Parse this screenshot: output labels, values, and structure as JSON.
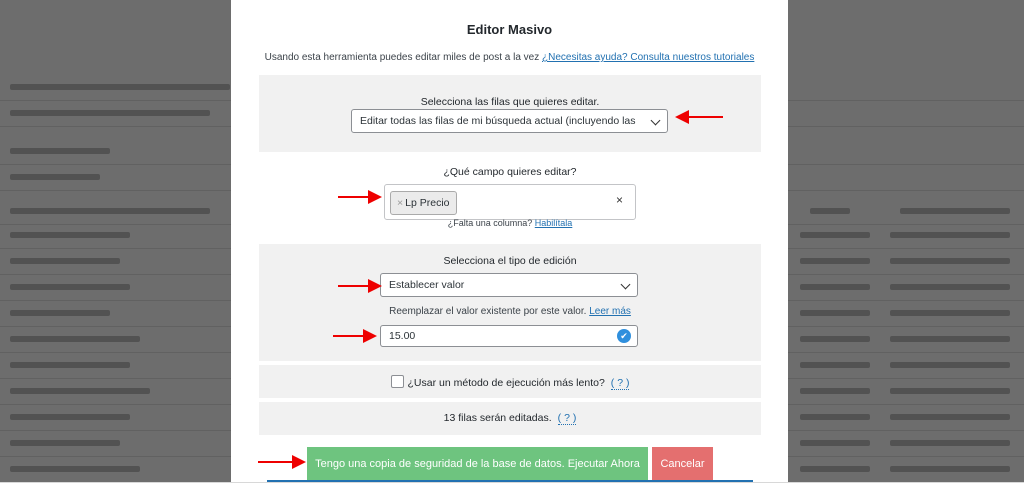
{
  "modal": {
    "title": "Editor Masivo",
    "intro_text": "Usando esta herramienta puedes editar miles de post a la vez",
    "intro_link": "¿Necesitas ayuda? Consulta nuestros tutoriales",
    "rows_section": {
      "label": "Selecciona las filas que quieres editar.",
      "selected": "Editar todas las filas de mi búsqueda actual (incluyendo las"
    },
    "field_section": {
      "label": "¿Qué campo quieres editar?",
      "tags": [
        "Lp Precio"
      ],
      "tag_remove": "×",
      "clear": "×",
      "missing_text": "¿Falta una columna?",
      "missing_link": "Habilítala"
    },
    "edit_type_section": {
      "label": "Selecciona el tipo de edición",
      "selected": "Establecer valor",
      "hint_text": "Reemplazar el valor existente por este valor.",
      "hint_link": "Leer más",
      "value": "15.00",
      "valid_icon": "checkmark-icon"
    },
    "slow_method": {
      "label": "¿Usar un método de ejecución más lento?",
      "help": "( ? )",
      "checked": false
    },
    "summary": {
      "text": "13 filas serán editadas.",
      "help": "( ? )"
    },
    "buttons": {
      "run": "Tengo una copia de seguridad de la base de datos. Ejecutar Ahora",
      "cancel": "Cancelar"
    }
  },
  "colors": {
    "run_button": "#6ec47f",
    "cancel_button": "#e46f6f",
    "link": "#2271b1",
    "annotation_arrow": "#e00000"
  }
}
